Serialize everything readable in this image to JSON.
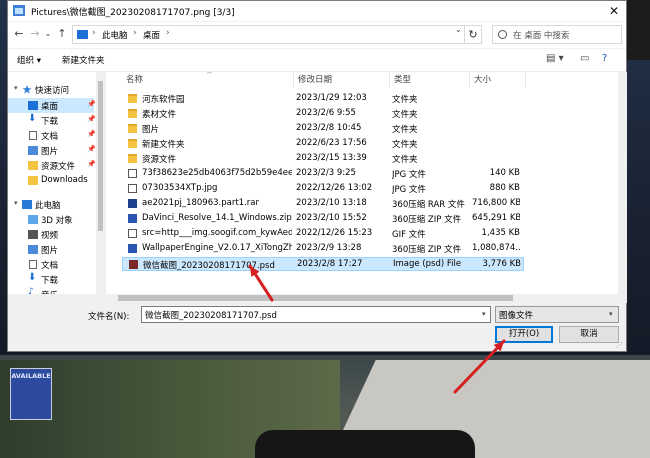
{
  "window": {
    "title": "Pictures\\微信截图_20230208171707.png [3/3]",
    "close_glyph": "✕"
  },
  "background": {
    "sign_text": "AVAILABLE"
  },
  "nav": {
    "back": "←",
    "forward": "→",
    "dropdown": "⌄",
    "up": "↑",
    "breadcrumb": [
      "此电脑",
      "桌面"
    ],
    "refresh": "↻",
    "search_placeholder": "在 桌面 中搜索"
  },
  "toolbar": {
    "organize": "组织 ▾",
    "new_folder": "新建文件夹",
    "view_icon": "▤ ▾",
    "pane_icon": "▭",
    "help_icon": "?"
  },
  "sidebar": {
    "items": [
      {
        "label": "快速访问",
        "level": 0,
        "icon": "star"
      },
      {
        "label": "桌面",
        "level": 1,
        "icon": "desktop",
        "selected": true,
        "pinned": true
      },
      {
        "label": "下载",
        "level": 1,
        "icon": "download",
        "pinned": true
      },
      {
        "label": "文档",
        "level": 1,
        "icon": "document",
        "pinned": true
      },
      {
        "label": "图片",
        "level": 1,
        "icon": "picture",
        "pinned": true
      },
      {
        "label": "资源文件",
        "level": 1,
        "icon": "folder",
        "pinned": true
      },
      {
        "label": "Downloads",
        "level": 1,
        "icon": "folder"
      },
      {
        "label": "此电脑",
        "level": 0,
        "icon": "pc"
      },
      {
        "label": "3D 对象",
        "level": 1,
        "icon": "cube"
      },
      {
        "label": "视频",
        "level": 1,
        "icon": "video"
      },
      {
        "label": "图片",
        "level": 1,
        "icon": "picture"
      },
      {
        "label": "文档",
        "level": 1,
        "icon": "document"
      },
      {
        "label": "下载",
        "level": 1,
        "icon": "download"
      },
      {
        "label": "音乐",
        "level": 1,
        "icon": "music"
      }
    ]
  },
  "columns": {
    "name": "名称",
    "date": "修改日期",
    "type": "类型",
    "size": "大小"
  },
  "files": [
    {
      "name": "河东软件园",
      "date": "2023/1/29 12:03",
      "type": "文件夹",
      "size": "",
      "kind": "folder"
    },
    {
      "name": "素材文件",
      "date": "2023/2/6 9:55",
      "type": "文件夹",
      "size": "",
      "kind": "folder"
    },
    {
      "name": "图片",
      "date": "2023/2/8 10:45",
      "type": "文件夹",
      "size": "",
      "kind": "folder"
    },
    {
      "name": "新建文件夹",
      "date": "2022/6/23 17:56",
      "type": "文件夹",
      "size": "",
      "kind": "folder"
    },
    {
      "name": "资源文件",
      "date": "2023/2/15 13:39",
      "type": "文件夹",
      "size": "",
      "kind": "folder"
    },
    {
      "name": "73f38623e25db4063f75d2b59e4ee79...",
      "date": "2023/2/3 9:25",
      "type": "JPG 文件",
      "size": "140 KB",
      "kind": "jpg"
    },
    {
      "name": "07303534XTp.jpg",
      "date": "2022/12/26 13:02",
      "type": "JPG 文件",
      "size": "880 KB",
      "kind": "jpg"
    },
    {
      "name": "ae2021pj_180963.part1.rar",
      "date": "2023/2/10 13:18",
      "type": "360压缩 RAR 文件",
      "size": "716,800 KB",
      "kind": "rar"
    },
    {
      "name": "DaVinci_Resolve_14.1_Windows.zip",
      "date": "2023/2/10 15:52",
      "type": "360压缩 ZIP 文件",
      "size": "645,291 KB",
      "kind": "zip"
    },
    {
      "name": "src=http___img.soogif.com_kywAedM...",
      "date": "2022/12/26 15:23",
      "type": "GIF 文件",
      "size": "1,435 KB",
      "kind": "gif"
    },
    {
      "name": "WallpaperEngine_V2.0.17_XiTongZhiJi...",
      "date": "2023/2/9 13:28",
      "type": "360压缩 ZIP 文件",
      "size": "1,080,874...",
      "kind": "zip"
    },
    {
      "name": "微信截图_20230208171707.psd",
      "date": "2023/2/8 17:27",
      "type": "Image (psd) File",
      "size": "3,776 KB",
      "kind": "psd",
      "selected": true
    }
  ],
  "footer": {
    "filename_label": "文件名(N):",
    "filename_value": "微信截图_20230208171707.psd",
    "filetype_value": "图像文件",
    "open_label": "打开(O)",
    "cancel_label": "取消"
  },
  "colors": {
    "selection": "#cce8ff",
    "accent": "#0078d7",
    "annotation_arrow": "#d42020"
  }
}
